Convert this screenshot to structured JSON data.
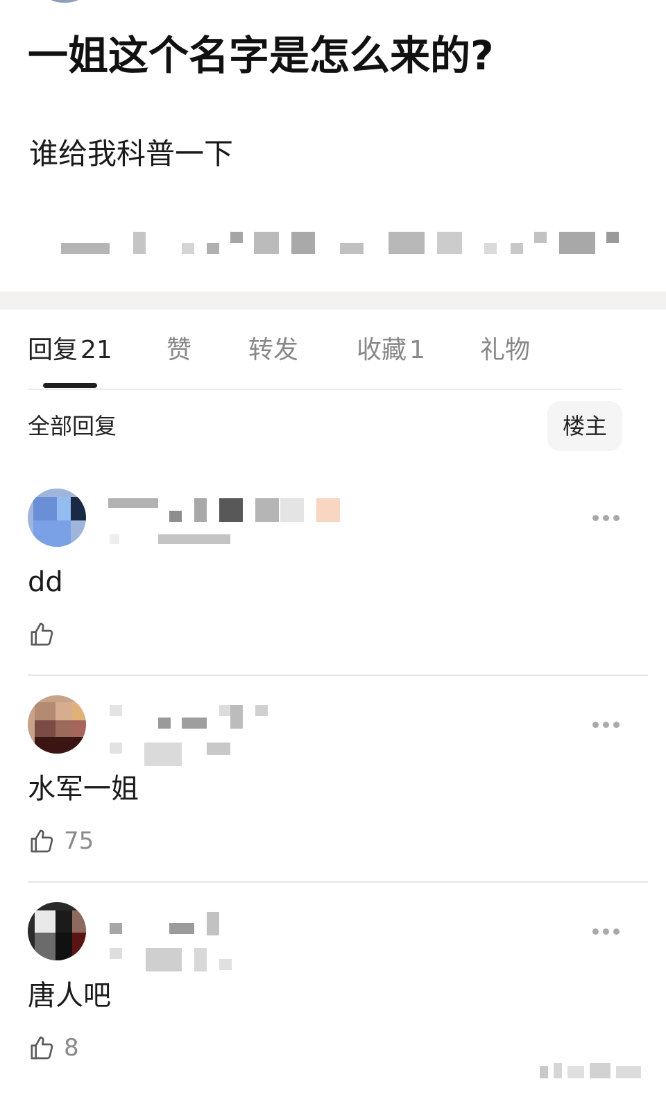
{
  "post": {
    "title": "一姐这个名字是怎么来的?",
    "body": "谁给我科普一下"
  },
  "tabs": [
    {
      "label": "回复",
      "count": "21",
      "active": true
    },
    {
      "label": "赞",
      "count": "",
      "active": false
    },
    {
      "label": "转发",
      "count": "",
      "active": false
    },
    {
      "label": "收藏",
      "count": "1",
      "active": false
    },
    {
      "label": "礼物",
      "count": "",
      "active": false
    }
  ],
  "filter": {
    "label": "全部回复",
    "op_button": "楼主"
  },
  "replies": [
    {
      "content": "dd",
      "likes": ""
    },
    {
      "content": "水军一姐",
      "likes": "75"
    },
    {
      "content": "唐人吧",
      "likes": "8"
    }
  ],
  "icons": {
    "like": "thumbs-up-icon",
    "more": "more-dots-icon"
  },
  "colors": {
    "text_primary": "#111111",
    "text_secondary": "#888888",
    "divider": "#f3f2f0",
    "indicator": "#1f1f1f"
  }
}
